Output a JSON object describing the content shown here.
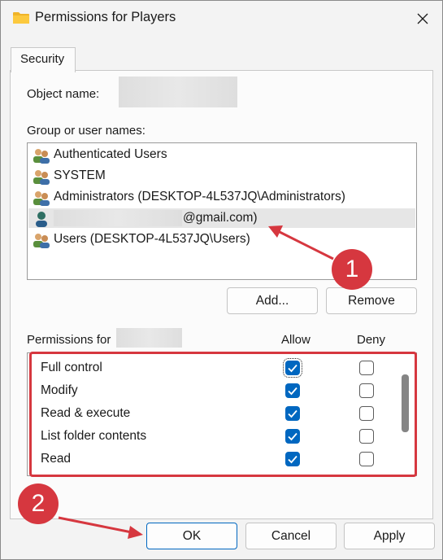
{
  "window": {
    "title": "Permissions for Players",
    "close_icon": "close-icon",
    "folder_icon": "folder-icon"
  },
  "tab": {
    "label": "Security"
  },
  "object_name": {
    "label": "Object name:"
  },
  "group_section": {
    "label": "Group or user names:",
    "items": [
      {
        "label": "Authenticated Users",
        "icon": "users-group-icon"
      },
      {
        "label": "SYSTEM",
        "icon": "users-group-icon"
      },
      {
        "label": "Administrators (DESKTOP-4L537JQ\\Administrators)",
        "icon": "users-group-icon"
      },
      {
        "label": "@gmail.com)",
        "icon": "user-icon",
        "selected": true
      },
      {
        "label": "Users (DESKTOP-4L537JQ\\Users)",
        "icon": "users-group-icon"
      }
    ]
  },
  "buttons": {
    "add": "Add...",
    "remove": "Remove",
    "ok": "OK",
    "cancel": "Cancel",
    "apply": "Apply"
  },
  "permissions": {
    "label": "Permissions for",
    "allow_header": "Allow",
    "deny_header": "Deny",
    "rows": [
      {
        "name": "Full control",
        "allow": true,
        "deny": false
      },
      {
        "name": "Modify",
        "allow": true,
        "deny": false
      },
      {
        "name": "Read & execute",
        "allow": true,
        "deny": false
      },
      {
        "name": "List folder contents",
        "allow": true,
        "deny": false
      },
      {
        "name": "Read",
        "allow": true,
        "deny": false
      }
    ]
  },
  "annotations": {
    "badge1": "1",
    "badge2": "2",
    "color": "#d6373f"
  },
  "colors": {
    "accent": "#0067c0",
    "annotation": "#d6373f"
  }
}
